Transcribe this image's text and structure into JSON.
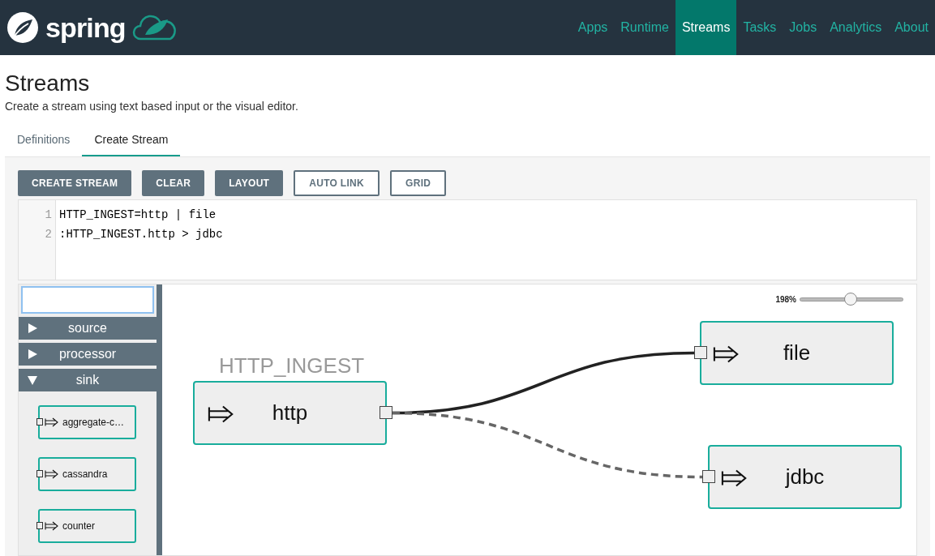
{
  "header": {
    "logo_text": "spring",
    "nav": [
      {
        "label": "Apps",
        "selected": false
      },
      {
        "label": "Runtime",
        "selected": false
      },
      {
        "label": "Streams",
        "selected": true
      },
      {
        "label": "Tasks",
        "selected": false
      },
      {
        "label": "Jobs",
        "selected": false
      },
      {
        "label": "Analytics",
        "selected": false
      },
      {
        "label": "About",
        "selected": false
      }
    ]
  },
  "page": {
    "title": "Streams",
    "subtitle": "Create a stream using text based input or the visual editor."
  },
  "tabs": [
    {
      "label": "Definitions",
      "selected": false
    },
    {
      "label": "Create Stream",
      "selected": true
    }
  ],
  "toolbar": [
    {
      "label": "CREATE STREAM",
      "kind": "filled"
    },
    {
      "label": "CLEAR",
      "kind": "filled"
    },
    {
      "label": "LAYOUT",
      "kind": "filled"
    },
    {
      "label": "AUTO LINK",
      "kind": "outline"
    },
    {
      "label": "GRID",
      "kind": "outline"
    }
  ],
  "editor": {
    "lines": [
      {
        "number": "1",
        "text": "HTTP_INGEST=http | file"
      },
      {
        "number": "2",
        "text": ":HTTP_INGEST.http > jdbc"
      }
    ]
  },
  "palette": {
    "groups": [
      {
        "name": "source",
        "expanded": false
      },
      {
        "name": "processor",
        "expanded": false
      },
      {
        "name": "sink",
        "expanded": true,
        "items": [
          "aggregate-c…",
          "cassandra",
          "counter"
        ]
      }
    ]
  },
  "canvas": {
    "zoom": {
      "reading": "198%",
      "level": 0.49
    },
    "nodes": [
      {
        "name": "http",
        "label": "HTTP_INGEST"
      },
      {
        "name": "file"
      },
      {
        "name": "jdbc"
      }
    ],
    "links": [
      {
        "tap": false
      },
      {
        "tap": true
      }
    ]
  }
}
